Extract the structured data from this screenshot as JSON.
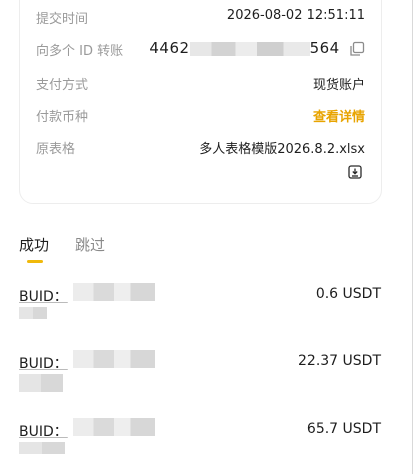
{
  "details": {
    "submit_time_label": "提交时间",
    "submit_time_value": "2026-08-02 12:51:11",
    "to_ids_label": "向多个 ID 转账",
    "to_ids_prefix": "4462",
    "to_ids_suffix": "564",
    "payment_method_label": "支付方式",
    "payment_method_value": "现货账户",
    "currency_label": "付款币种",
    "currency_value": "查看详情",
    "original_sheet_label": "原表格",
    "original_sheet_value": "多人表格模版2026.8.2.xlsx"
  },
  "tabs": [
    {
      "label": "成功",
      "active": true
    },
    {
      "label": "跳过",
      "active": false
    }
  ],
  "entries": [
    {
      "buid_label": "BUID：",
      "amount": "0.6 USDT"
    },
    {
      "buid_label": "BUID：",
      "amount": "22.37 USDT"
    },
    {
      "buid_label": "BUID：",
      "amount": "65.7 USDT"
    }
  ],
  "colors": {
    "accent": "#f0b90b",
    "link": "#e8a400",
    "muted": "#9a9a9a"
  },
  "icons": {
    "copy": "copy-icon",
    "download": "download-icon"
  }
}
